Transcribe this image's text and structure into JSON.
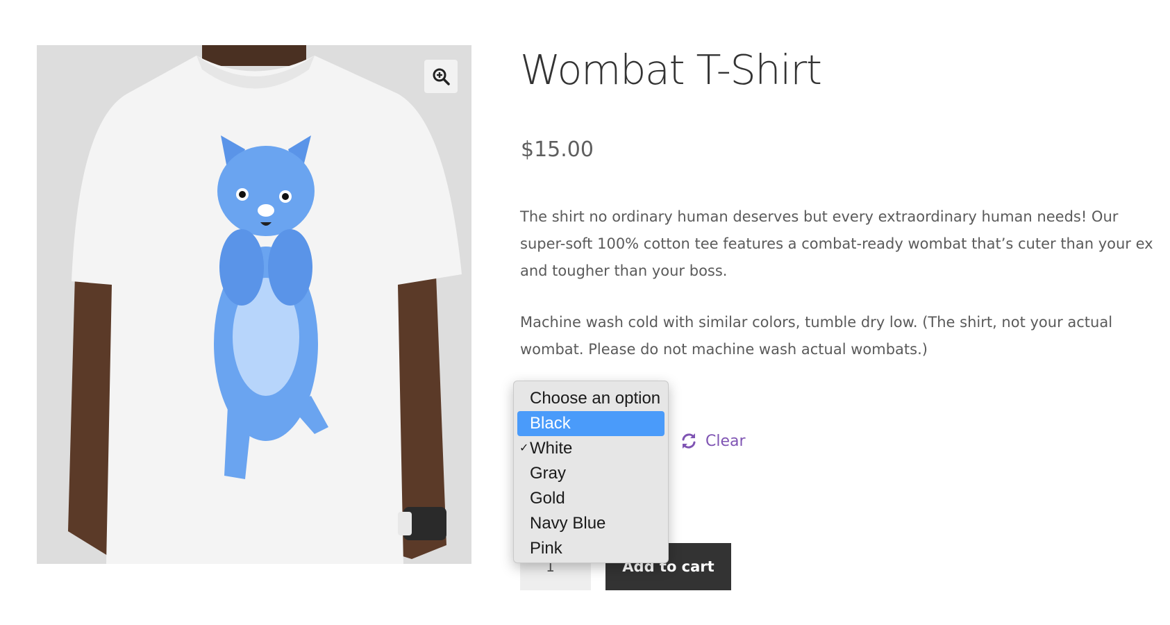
{
  "product": {
    "title": "Wombat T-Shirt",
    "price": "$15.00",
    "description": [
      "The shirt no ordinary human deserves but every extraordinary human needs! Our super-soft 100% cotton tee features a combat-ready wombat that’s cuter than your ex and tougher than your boss.",
      "Machine wash cold with similar colors, tumble dry low. (The shirt, not your actual wombat. Please do not machine wash actual wombats.)"
    ]
  },
  "gallery": {
    "zoom_icon": "magnifier-plus-icon"
  },
  "variation": {
    "clear_label": "Clear",
    "clear_icon": "refresh-icon",
    "options": [
      "Choose an option",
      "Black",
      "White",
      "Gray",
      "Gold",
      "Navy Blue",
      "Pink"
    ],
    "highlighted": "Black",
    "selected": "White",
    "check_glyph": "✓"
  },
  "cart": {
    "quantity": "1",
    "add_label": "Add to cart"
  },
  "colors": {
    "accent": "#7f54b3",
    "highlight": "#4a9bfa",
    "button": "#333333"
  }
}
